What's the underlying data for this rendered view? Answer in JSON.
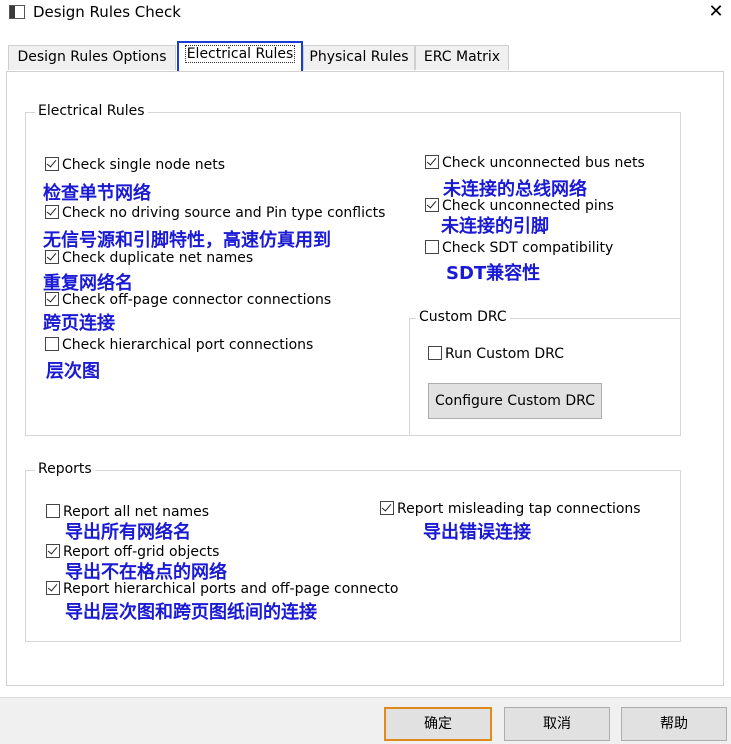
{
  "window": {
    "title": "Design Rules Check",
    "close_label": "✕",
    "app_icon": "window-icon"
  },
  "tabs": [
    {
      "label": "Design Rules Options"
    },
    {
      "label": "Electrical Rules",
      "active": true
    },
    {
      "label": "Physical Rules"
    },
    {
      "label": "ERC Matrix"
    }
  ],
  "electrical": {
    "group_title": "Electrical Rules",
    "items": [
      {
        "label": "Check single node nets",
        "checked": true,
        "note": "检查单节网络"
      },
      {
        "label": "Check no driving source and Pin type conflicts",
        "checked": true,
        "note": "无信号源和引脚特性，高速仿真用到"
      },
      {
        "label": "Check duplicate net names",
        "checked": true,
        "note": "重复网络名"
      },
      {
        "label": "Check off-page connector connections",
        "checked": true,
        "note": "跨页连接"
      },
      {
        "label": "Check hierarchical port connections",
        "checked": false,
        "note": "层次图"
      },
      {
        "label": "Check unconnected bus nets",
        "checked": true,
        "note": "未连接的总线网络"
      },
      {
        "label": "Check unconnected pins",
        "checked": true,
        "note": "未连接的引脚"
      },
      {
        "label": "Check SDT compatibility",
        "checked": false,
        "note": "SDT兼容性"
      }
    ]
  },
  "custom_drc": {
    "group_title": "Custom DRC",
    "run_label": "Run Custom DRC",
    "run_checked": false,
    "configure_label": "Configure Custom DRC"
  },
  "reports": {
    "group_title": "Reports",
    "items": [
      {
        "label": "Report all net names",
        "checked": false,
        "note": "导出所有网络名"
      },
      {
        "label": "Report off-grid objects",
        "checked": true,
        "note": "导出不在格点的网络"
      },
      {
        "label": "Report hierarchical ports and off-page connecto",
        "checked": true,
        "note": "导出层次图和跨页图纸间的连接"
      },
      {
        "label": "Report misleading tap connections",
        "checked": true,
        "note": "导出错误连接"
      }
    ]
  },
  "buttons": {
    "ok": "确定",
    "cancel": "取消",
    "help": "帮助"
  },
  "colors": {
    "annotation": "#1a1ad4",
    "active_tab_border": "#1a3cd6",
    "default_button_border": "#e08a1e"
  }
}
